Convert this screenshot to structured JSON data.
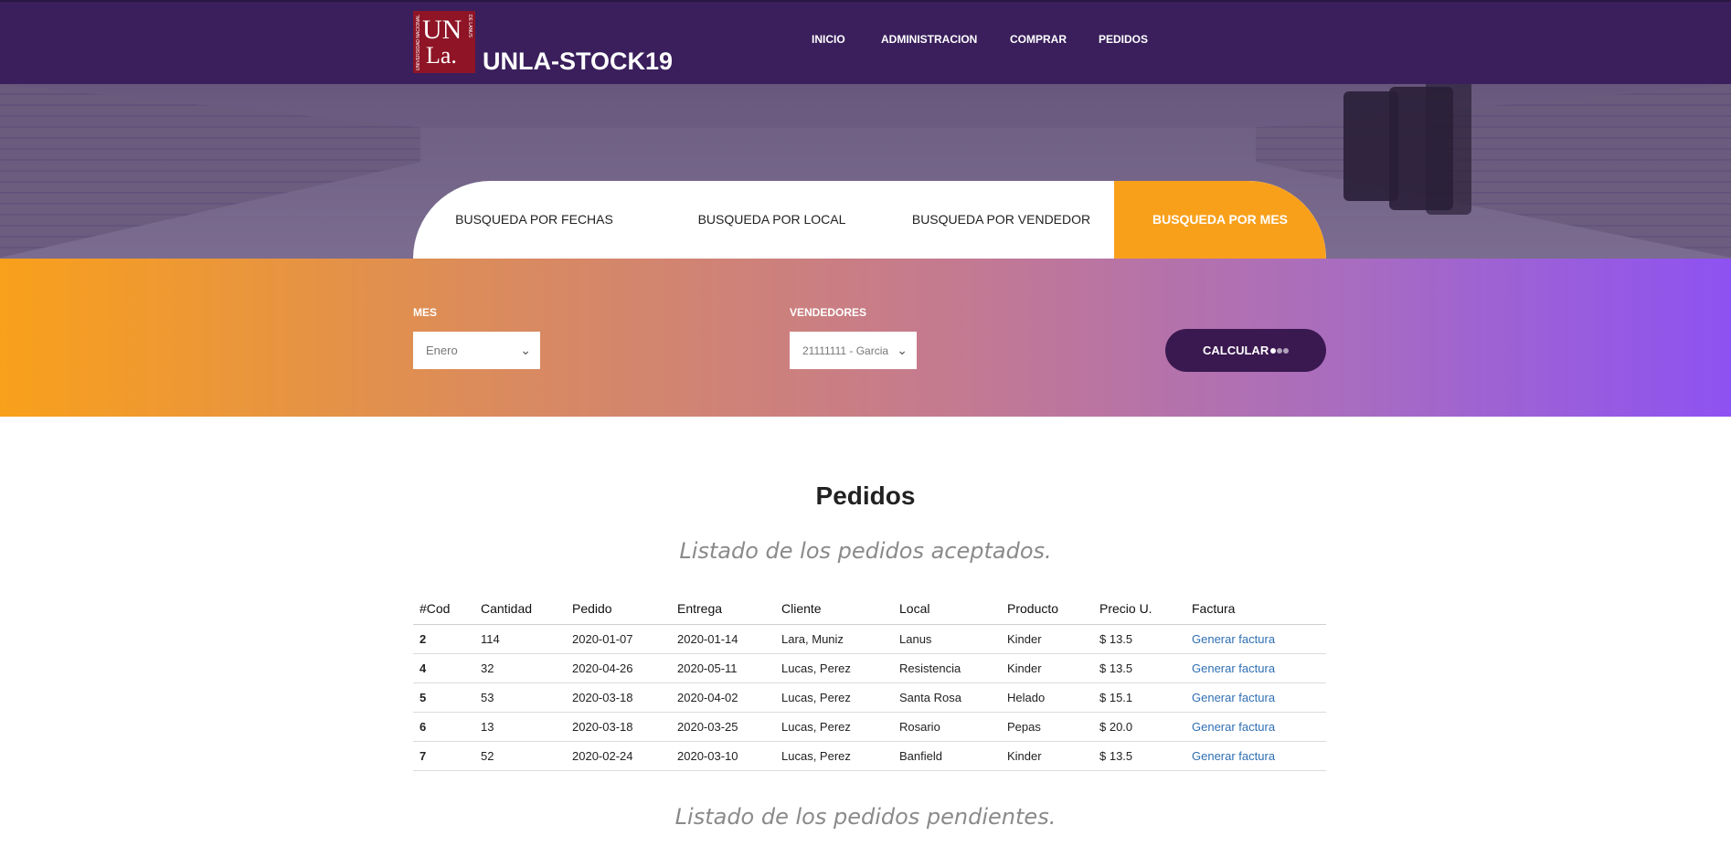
{
  "brand": {
    "logo_main": "UN",
    "logo_sub": "La.",
    "logo_arc_left": "UNIVERSIDAD NACIONAL",
    "logo_arc_right": "DE LANUS",
    "name": "UNLA-STOCK19"
  },
  "nav": [
    "INICIO",
    "ADMINISTRACION",
    "COMPRAR",
    "PEDIDOS"
  ],
  "tabs": [
    {
      "label": "BUSQUEDA POR FECHAS"
    },
    {
      "label": "BUSQUEDA POR LOCAL"
    },
    {
      "label": "BUSQUEDA POR VENDEDOR"
    },
    {
      "label": "BUSQUEDA POR MES",
      "active": true
    }
  ],
  "filters": {
    "mes_label": "MES",
    "mes_value": "Enero",
    "vendedores_label": "VENDEDORES",
    "vendedores_value": "21111111 - Garcia",
    "calc_label": "CALCULAR"
  },
  "content": {
    "title": "Pedidos",
    "accepted_subtitle": "Listado de los pedidos aceptados.",
    "pending_subtitle": "Listado de los pedidos pendientes."
  },
  "table": {
    "headers": [
      "#Cod",
      "Cantidad",
      "Pedido",
      "Entrega",
      "Cliente",
      "Local",
      "Producto",
      "Precio U.",
      "Factura"
    ],
    "rows": [
      [
        "2",
        "114",
        "2020-01-07",
        "2020-01-14",
        "Lara, Muniz",
        "Lanus",
        "Kinder",
        "$ 13.5",
        "Generar factura"
      ],
      [
        "4",
        "32",
        "2020-04-26",
        "2020-05-11",
        "Lucas, Perez",
        "Resistencia",
        "Kinder",
        "$ 13.5",
        "Generar factura"
      ],
      [
        "5",
        "53",
        "2020-03-18",
        "2020-04-02",
        "Lucas, Perez",
        "Santa Rosa",
        "Helado",
        "$ 15.1",
        "Generar factura"
      ],
      [
        "6",
        "13",
        "2020-03-18",
        "2020-03-25",
        "Lucas, Perez",
        "Rosario",
        "Pepas",
        "$ 20.0",
        "Generar factura"
      ],
      [
        "7",
        "52",
        "2020-02-24",
        "2020-03-10",
        "Lucas, Perez",
        "Banfield",
        "Kinder",
        "$ 13.5",
        "Generar factura"
      ]
    ]
  },
  "colors": {
    "topbar": "#3a1f5c",
    "accent_orange": "#f9a01b",
    "accent_purple": "#8e52f2",
    "calc_button": "#3a1850",
    "link": "#2f6fb3"
  }
}
